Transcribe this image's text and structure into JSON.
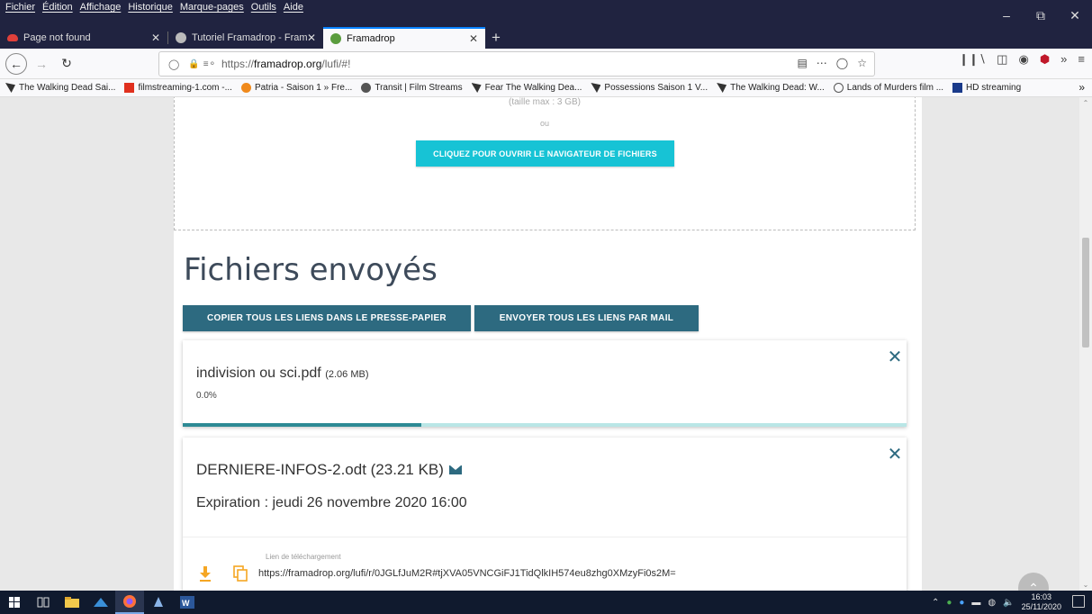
{
  "menu": [
    "Fichier",
    "Édition",
    "Affichage",
    "Historique",
    "Marque-pages",
    "Outils",
    "Aide"
  ],
  "tabs": [
    {
      "title": "Page not found",
      "favicon_color": "#e0403a"
    },
    {
      "title": "Tutoriel Framadrop - FramaTut",
      "favicon_color": "#bbbbbb"
    },
    {
      "title": "Framadrop",
      "favicon_color": "#5a9c3e"
    }
  ],
  "address": {
    "prefix": "https://",
    "host": "framadrop.org",
    "path": "/lufi/#!"
  },
  "bookmarks": [
    {
      "label": "The Walking Dead Sai...",
      "color": "#333333"
    },
    {
      "label": "filmstreaming-1.com -...",
      "color": "#e0301e"
    },
    {
      "label": "Patria - Saison 1 » Fre...",
      "color": "#f08a1c"
    },
    {
      "label": "Transit | Film Streams",
      "color": "#555555"
    },
    {
      "label": "Fear The Walking Dea...",
      "color": "#333333"
    },
    {
      "label": "Possessions Saison 1 V...",
      "color": "#333333"
    },
    {
      "label": "The Walking Dead: W...",
      "color": "#333333"
    },
    {
      "label": "Lands of Murders film ...",
      "color": "#555555"
    },
    {
      "label": "HD streaming",
      "color": "#1a3a8a"
    }
  ],
  "upload": {
    "max_size": "(taille max : 3 GB)",
    "or": "ou",
    "browse_button": "CLIQUEZ POUR OUVRIR LE NAVIGATEUR DE FICHIERS"
  },
  "sent": {
    "heading": "Fichiers envoyés",
    "copy_all": "COPIER TOUS LES LIENS DANS LE PRESSE-PAPIER",
    "mail_all": "ENVOYER TOUS LES LIENS PAR MAIL"
  },
  "file1": {
    "name": "indivision ou sci.pdf",
    "size": "(2.06 MB)",
    "percent": "0.0%",
    "progress": 0.33
  },
  "file2": {
    "name": "DERNIERE-INFOS-2.odt (23.21 KB)",
    "expiration": "Expiration : jeudi 26 novembre 2020 16:00",
    "link_label": "Lien de téléchargement",
    "link": "https://framadrop.org/lufi/r/0JGLfJuM2R#tjXVA05VNCGiFJ1TidQlkIH574eu8zhg0XMzyFi0s2M="
  },
  "clock": {
    "time": "16:03",
    "date": "25/11/2020"
  },
  "colors": {
    "accent": "#2d6a80",
    "cyan": "#17c3d5",
    "taskbar": "#101a2e"
  }
}
